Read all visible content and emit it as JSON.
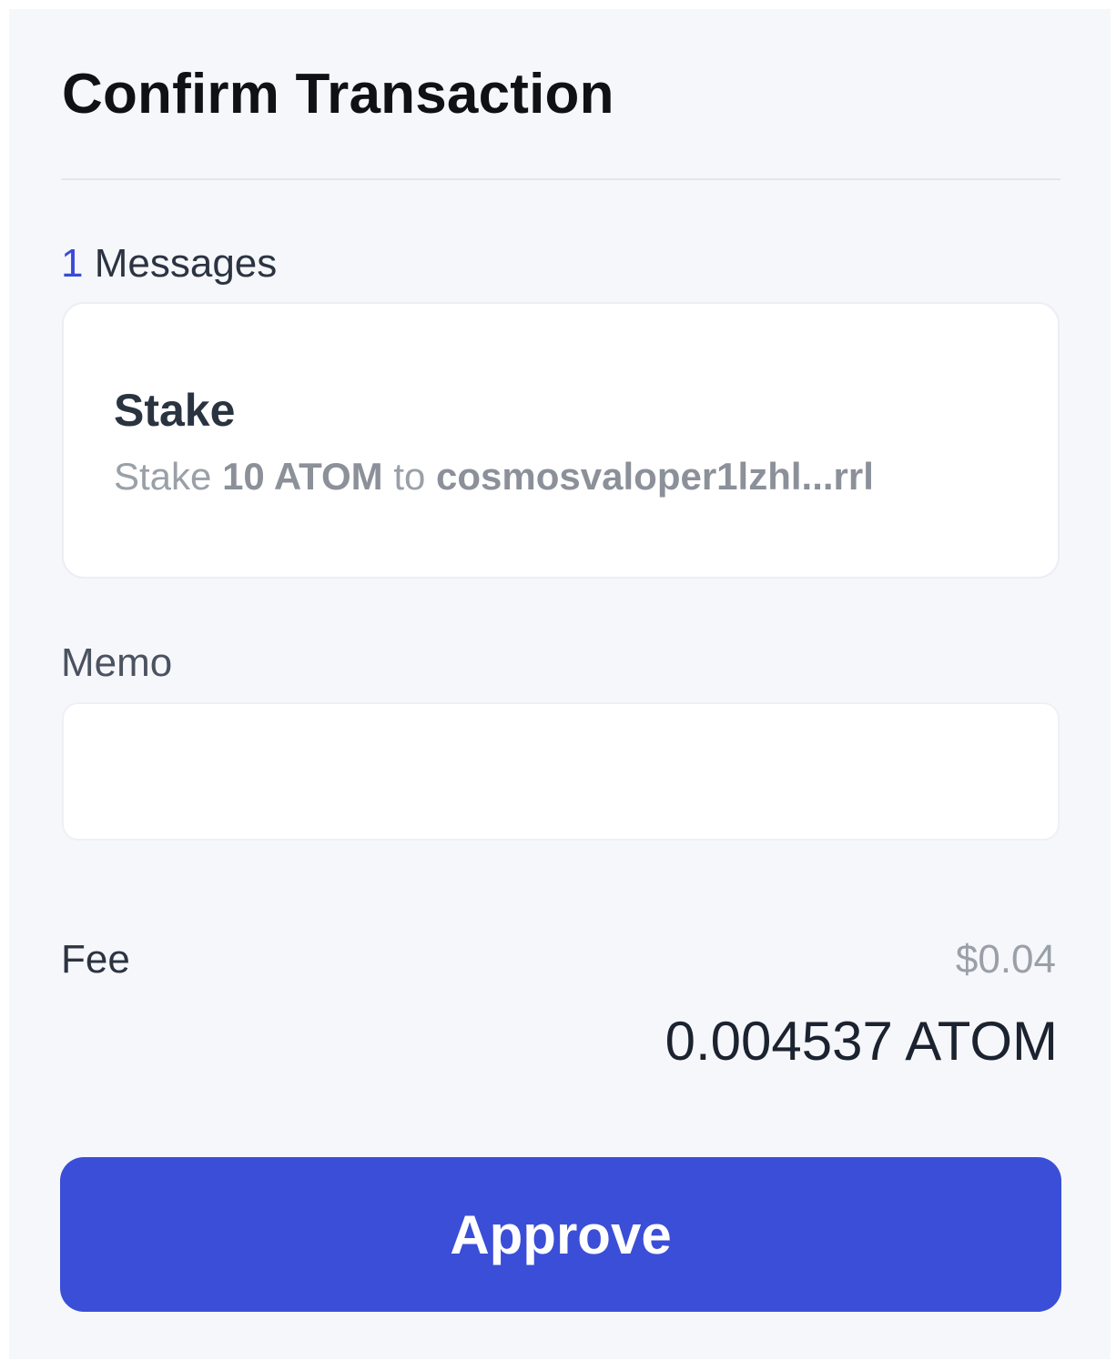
{
  "header": {
    "title": "Confirm Transaction"
  },
  "messages": {
    "count": "1",
    "label": "Messages",
    "items": [
      {
        "title": "Stake",
        "desc_prefix": "Stake",
        "amount": "10 ATOM",
        "desc_middle": "to",
        "validator": "cosmosvaloper1lzhl...rrl"
      }
    ]
  },
  "memo": {
    "label": "Memo",
    "value": "",
    "placeholder": ""
  },
  "fee": {
    "label": "Fee",
    "usd": "$0.04",
    "amount": "0.004537 ATOM"
  },
  "actions": {
    "approve_label": "Approve"
  },
  "colors": {
    "accent": "#3a4ed8",
    "background": "#f6f7fb"
  }
}
